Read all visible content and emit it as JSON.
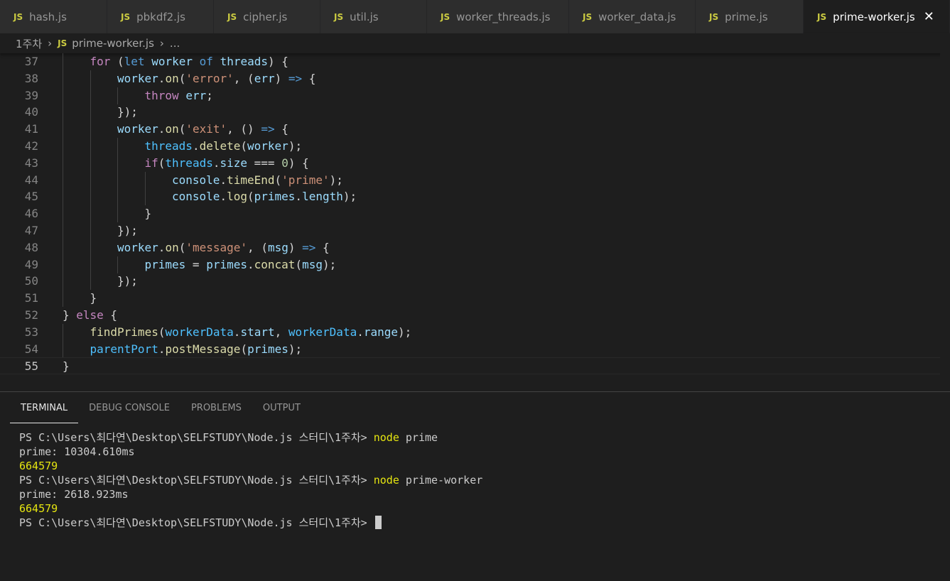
{
  "tabs": [
    {
      "label": "hash.js",
      "active": false
    },
    {
      "label": "pbkdf2.js",
      "active": false
    },
    {
      "label": "cipher.js",
      "active": false
    },
    {
      "label": "util.js",
      "active": false
    },
    {
      "label": "worker_threads.js",
      "active": false
    },
    {
      "label": "worker_data.js",
      "active": false
    },
    {
      "label": "prime.js",
      "active": false
    },
    {
      "label": "prime-worker.js",
      "active": true
    }
  ],
  "file_badge": "JS",
  "close_glyph": "✕",
  "breadcrumb": {
    "folder": "1주차",
    "file": "prime-worker.js",
    "symbol": "..."
  },
  "editor": {
    "current_line": 55,
    "lines": [
      {
        "no": 37,
        "indent": 1,
        "tokens": [
          [
            "kw",
            "for"
          ],
          [
            "pn",
            " ("
          ],
          [
            "st",
            "let"
          ],
          [
            "pn",
            " "
          ],
          [
            "var",
            "worker"
          ],
          [
            "pn",
            " "
          ],
          [
            "st",
            "of"
          ],
          [
            "pn",
            " "
          ],
          [
            "var",
            "threads"
          ],
          [
            "pn",
            ") {"
          ]
        ]
      },
      {
        "no": 38,
        "indent": 2,
        "tokens": [
          [
            "var",
            "worker"
          ],
          [
            "pn",
            "."
          ],
          [
            "fn",
            "on"
          ],
          [
            "pn",
            "("
          ],
          [
            "str",
            "'error'"
          ],
          [
            "pn",
            ", ("
          ],
          [
            "var",
            "err"
          ],
          [
            "pn",
            ") "
          ],
          [
            "st",
            "=>"
          ],
          [
            "pn",
            " {"
          ]
        ]
      },
      {
        "no": 39,
        "indent": 3,
        "tokens": [
          [
            "kw",
            "throw"
          ],
          [
            "pn",
            " "
          ],
          [
            "var",
            "err"
          ],
          [
            "pn",
            ";"
          ]
        ]
      },
      {
        "no": 40,
        "indent": 2,
        "tokens": [
          [
            "pn",
            "});"
          ]
        ]
      },
      {
        "no": 41,
        "indent": 2,
        "tokens": [
          [
            "var",
            "worker"
          ],
          [
            "pn",
            "."
          ],
          [
            "fn",
            "on"
          ],
          [
            "pn",
            "("
          ],
          [
            "str",
            "'exit'"
          ],
          [
            "pn",
            ", () "
          ],
          [
            "st",
            "=>"
          ],
          [
            "pn",
            " {"
          ]
        ]
      },
      {
        "no": 42,
        "indent": 3,
        "tokens": [
          [
            "cls",
            "threads"
          ],
          [
            "pn",
            "."
          ],
          [
            "fn",
            "delete"
          ],
          [
            "pn",
            "("
          ],
          [
            "var",
            "worker"
          ],
          [
            "pn",
            ");"
          ]
        ]
      },
      {
        "no": 43,
        "indent": 3,
        "tokens": [
          [
            "kw",
            "if"
          ],
          [
            "pn",
            "("
          ],
          [
            "cls",
            "threads"
          ],
          [
            "pn",
            "."
          ],
          [
            "var",
            "size"
          ],
          [
            "pn",
            " === "
          ],
          [
            "num",
            "0"
          ],
          [
            "pn",
            ") {"
          ]
        ]
      },
      {
        "no": 44,
        "indent": 4,
        "tokens": [
          [
            "var",
            "console"
          ],
          [
            "pn",
            "."
          ],
          [
            "fn",
            "timeEnd"
          ],
          [
            "pn",
            "("
          ],
          [
            "str",
            "'prime'"
          ],
          [
            "pn",
            ");"
          ]
        ]
      },
      {
        "no": 45,
        "indent": 4,
        "tokens": [
          [
            "var",
            "console"
          ],
          [
            "pn",
            "."
          ],
          [
            "fn",
            "log"
          ],
          [
            "pn",
            "("
          ],
          [
            "var",
            "primes"
          ],
          [
            "pn",
            "."
          ],
          [
            "var",
            "length"
          ],
          [
            "pn",
            ");"
          ]
        ]
      },
      {
        "no": 46,
        "indent": 3,
        "tokens": [
          [
            "pn",
            "}"
          ]
        ]
      },
      {
        "no": 47,
        "indent": 2,
        "tokens": [
          [
            "pn",
            "});"
          ]
        ]
      },
      {
        "no": 48,
        "indent": 2,
        "tokens": [
          [
            "var",
            "worker"
          ],
          [
            "pn",
            "."
          ],
          [
            "fn",
            "on"
          ],
          [
            "pn",
            "("
          ],
          [
            "str",
            "'message'"
          ],
          [
            "pn",
            ", ("
          ],
          [
            "var",
            "msg"
          ],
          [
            "pn",
            ") "
          ],
          [
            "st",
            "=>"
          ],
          [
            "pn",
            " {"
          ]
        ]
      },
      {
        "no": 49,
        "indent": 3,
        "tokens": [
          [
            "var",
            "primes"
          ],
          [
            "pn",
            " = "
          ],
          [
            "var",
            "primes"
          ],
          [
            "pn",
            "."
          ],
          [
            "fn",
            "concat"
          ],
          [
            "pn",
            "("
          ],
          [
            "var",
            "msg"
          ],
          [
            "pn",
            ");"
          ]
        ]
      },
      {
        "no": 50,
        "indent": 2,
        "tokens": [
          [
            "pn",
            "});"
          ]
        ]
      },
      {
        "no": 51,
        "indent": 1,
        "tokens": [
          [
            "pn",
            "}"
          ]
        ]
      },
      {
        "no": 52,
        "indent": 0,
        "tokens": [
          [
            "pn",
            "} "
          ],
          [
            "kw",
            "else"
          ],
          [
            "pn",
            " {"
          ]
        ]
      },
      {
        "no": 53,
        "indent": 1,
        "tokens": [
          [
            "fn",
            "findPrimes"
          ],
          [
            "pn",
            "("
          ],
          [
            "cls",
            "workerData"
          ],
          [
            "pn",
            "."
          ],
          [
            "var",
            "start"
          ],
          [
            "pn",
            ", "
          ],
          [
            "cls",
            "workerData"
          ],
          [
            "pn",
            "."
          ],
          [
            "var",
            "range"
          ],
          [
            "pn",
            ");"
          ]
        ]
      },
      {
        "no": 54,
        "indent": 1,
        "tokens": [
          [
            "cls",
            "parentPort"
          ],
          [
            "pn",
            "."
          ],
          [
            "fn",
            "postMessage"
          ],
          [
            "pn",
            "("
          ],
          [
            "var",
            "primes"
          ],
          [
            "pn",
            ");"
          ]
        ]
      },
      {
        "no": 55,
        "indent": 0,
        "tokens": [
          [
            "pn",
            "}"
          ]
        ]
      }
    ]
  },
  "panel": {
    "tabs": [
      {
        "label": "TERMINAL",
        "active": true
      },
      {
        "label": "DEBUG CONSOLE",
        "active": false
      },
      {
        "label": "PROBLEMS",
        "active": false
      },
      {
        "label": "OUTPUT",
        "active": false
      }
    ],
    "terminal_lines": [
      {
        "prompt": "PS C:\\Users\\최다연\\Desktop\\SELFSTUDY\\Node.js 스터디\\1주차> ",
        "cmd": "node",
        "args": " prime"
      },
      {
        "text": "prime: 10304.610ms"
      },
      {
        "result": "664579"
      },
      {
        "prompt": "PS C:\\Users\\최다연\\Desktop\\SELFSTUDY\\Node.js 스터디\\1주차> ",
        "cmd": "node",
        "args": " prime-worker"
      },
      {
        "text": "prime: 2618.923ms"
      },
      {
        "result": "664579"
      },
      {
        "prompt": "PS C:\\Users\\최다연\\Desktop\\SELFSTUDY\\Node.js 스터디\\1주차> ",
        "cursor": true
      }
    ]
  },
  "colors": {
    "keyword": "#c586c0",
    "storage": "#569cd6",
    "variable": "#9cdcfe",
    "function": "#dcdcaa",
    "string": "#ce9178",
    "number": "#b5cea8",
    "terminal_yellow": "#e5e510"
  }
}
